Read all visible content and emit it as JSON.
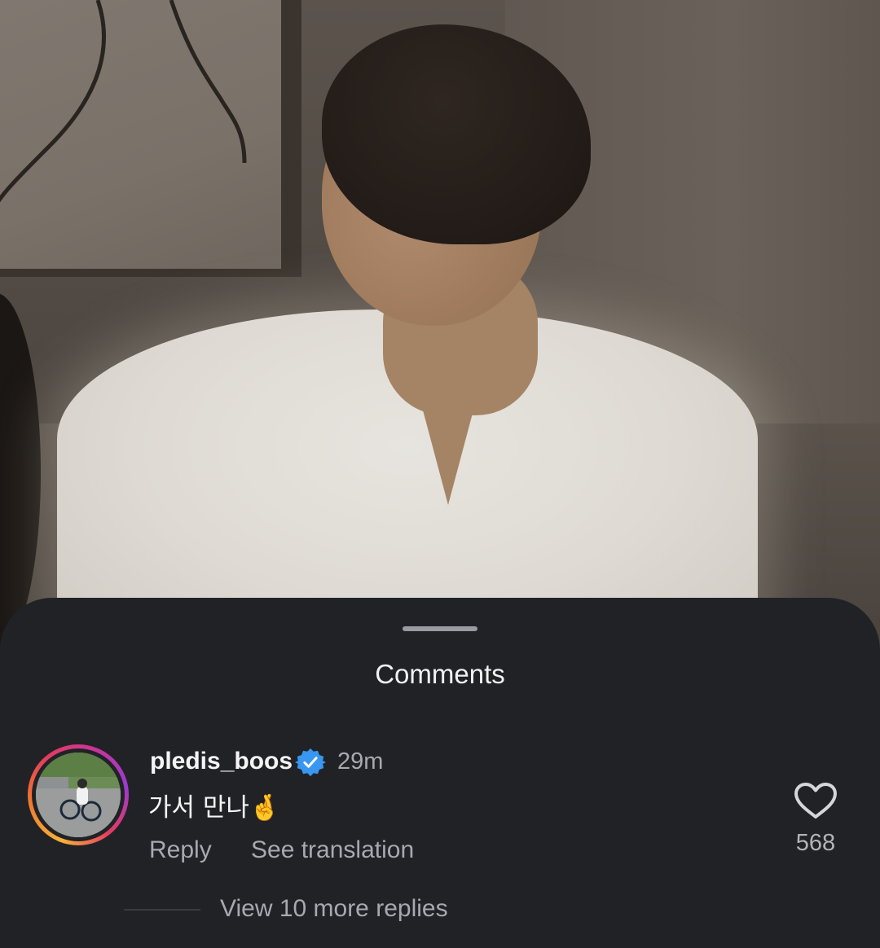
{
  "sheet": {
    "title": "Comments"
  },
  "comment": {
    "username": "pledis_boos",
    "verified": true,
    "time": "29m",
    "text": "가서 만나🤞",
    "reply_label": "Reply",
    "translate_label": "See translation",
    "like_count": "568",
    "view_replies_label": "View 10 more replies"
  },
  "icons": {
    "verified": "verified-badge-icon",
    "like": "heart-outline-icon"
  },
  "colors": {
    "sheet_background": "#212226",
    "verified_blue": "#3897f0",
    "secondary_text": "#a8a9ae"
  }
}
